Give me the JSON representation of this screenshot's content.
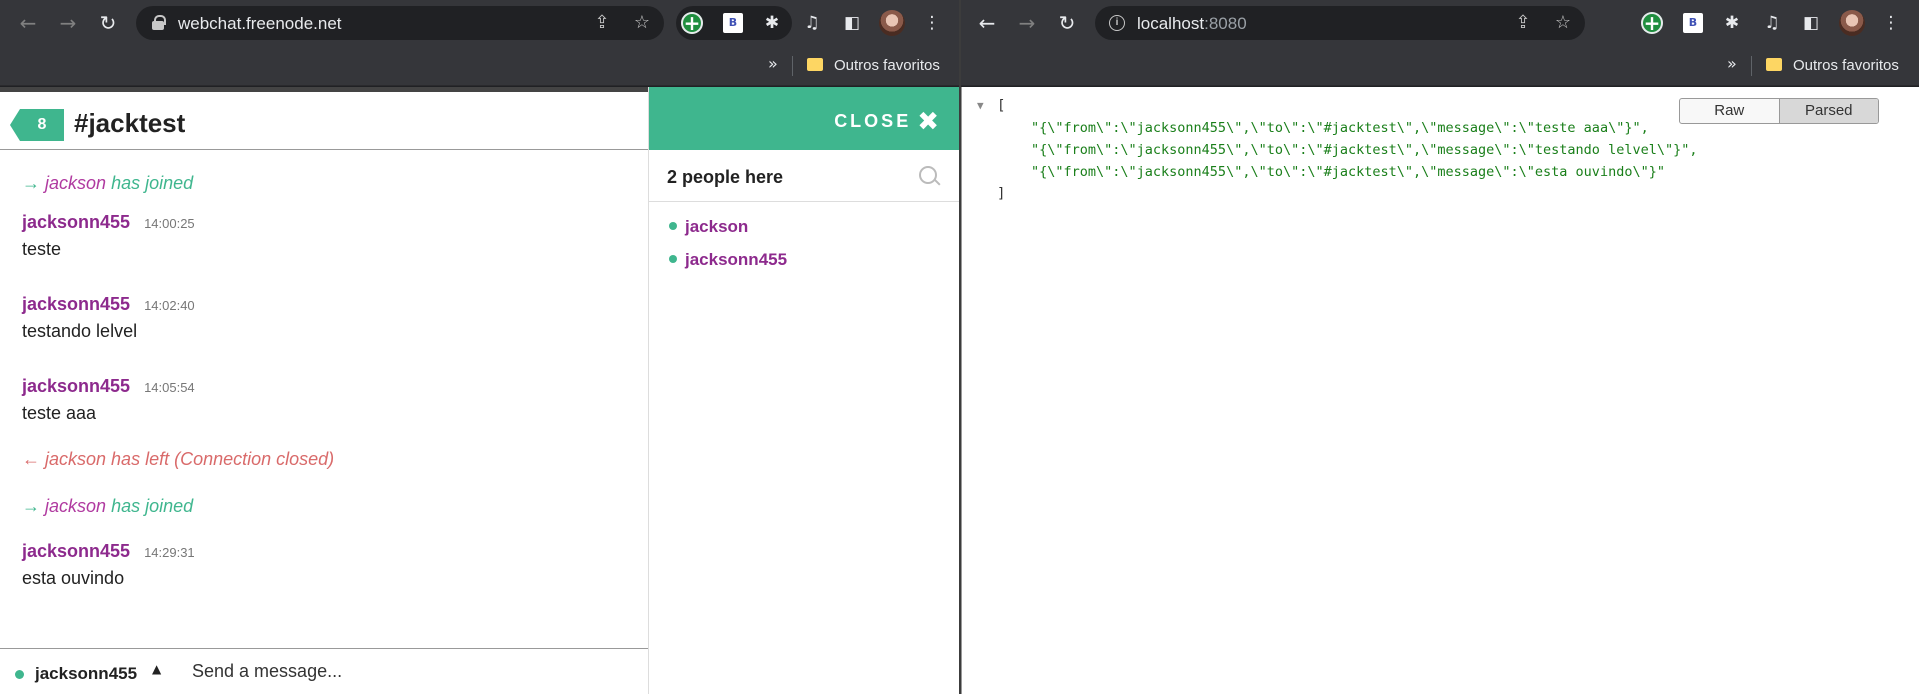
{
  "left": {
    "url": "webchat.freenode.net",
    "bookmarks_label": "Outros favoritos",
    "chat": {
      "unread_count": "8",
      "channel": "#jacktest",
      "close_label": "CLOSE",
      "people_count": "2 people here",
      "users": [
        "jackson",
        "jacksonn455"
      ],
      "events": [
        {
          "type": "join",
          "arrow": "→",
          "nick": "jackson",
          "text": "has joined"
        },
        {
          "type": "msg",
          "nick": "jacksonn455",
          "time": "14:00:25",
          "text": "teste"
        },
        {
          "type": "msg",
          "nick": "jacksonn455",
          "time": "14:02:40",
          "text": "testando lelvel"
        },
        {
          "type": "msg",
          "nick": "jacksonn455",
          "time": "14:05:54",
          "text": "teste aaa"
        },
        {
          "type": "leave",
          "arrow": "←",
          "text": "jackson has left (Connection closed)"
        },
        {
          "type": "join",
          "arrow": "→",
          "nick": "jackson",
          "text": "has joined"
        },
        {
          "type": "msg",
          "nick": "jacksonn455",
          "time": "14:29:31",
          "text": "esta ouvindo"
        }
      ],
      "current_nick": "jacksonn455",
      "message_placeholder": "Send a message..."
    }
  },
  "right": {
    "url_host": "localhost",
    "url_port": ":8080",
    "bookmarks_label": "Outros favoritos",
    "json": {
      "open_bracket": "[",
      "close_bracket": "]",
      "lines": [
        "\"{\\\"from\\\":\\\"jacksonn455\\\",\\\"to\\\":\\\"#jacktest\\\",\\\"message\\\":\\\"teste aaa\\\"}\",",
        "\"{\\\"from\\\":\\\"jacksonn455\\\",\\\"to\\\":\\\"#jacktest\\\",\\\"message\\\":\\\"testando lelvel\\\"}\",",
        "\"{\\\"from\\\":\\\"jacksonn455\\\",\\\"to\\\":\\\"#jacktest\\\",\\\"message\\\":\\\"esta ouvindo\\\"}\""
      ],
      "raw_label": "Raw",
      "parsed_label": "Parsed"
    }
  },
  "colors": {
    "accent_green": "#3fb68e",
    "nick_purple": "#8d2a8d",
    "leave_red": "#d96a6a",
    "json_string": "#1a7f1a"
  },
  "icons": [
    "back-icon",
    "forward-icon",
    "reload-icon",
    "lock-icon",
    "info-icon",
    "share-icon",
    "star-icon",
    "extension-plus-icon",
    "extension-b-icon",
    "puzzle-icon",
    "media-icon",
    "sidepanel-icon",
    "avatar",
    "kebab-menu-icon",
    "folder-icon",
    "search-icon",
    "close-icon",
    "caret-up-icon",
    "collapse-triangle-icon"
  ]
}
